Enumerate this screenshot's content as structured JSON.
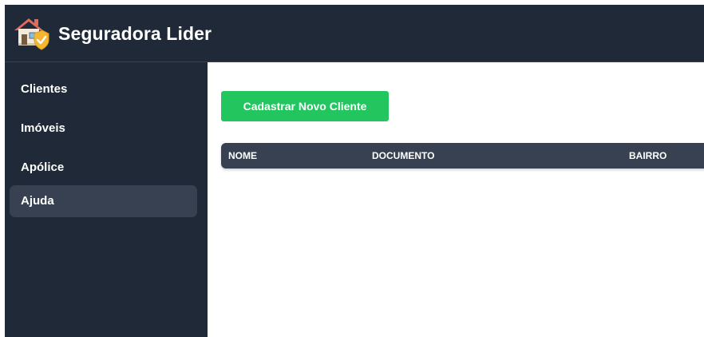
{
  "header": {
    "title": "Seguradora Lider",
    "logo_icon": "house-shield-icon"
  },
  "sidebar": {
    "items": [
      {
        "label": "Clientes",
        "active": false
      },
      {
        "label": "Imóveis",
        "active": false
      },
      {
        "label": "Apólice",
        "active": false
      },
      {
        "label": "Ajuda",
        "active": true
      }
    ]
  },
  "main": {
    "add_button_label": "Cadastrar Novo Cliente",
    "table": {
      "columns": [
        "NOME",
        "DOCUMENTO",
        "BAIRRO"
      ],
      "rows": []
    }
  },
  "colors": {
    "header_bg": "#1f2937",
    "sidebar_bg": "#1f2937",
    "active_item_bg": "#374151",
    "table_header_bg": "#374151",
    "primary_button": "#22c55e"
  }
}
